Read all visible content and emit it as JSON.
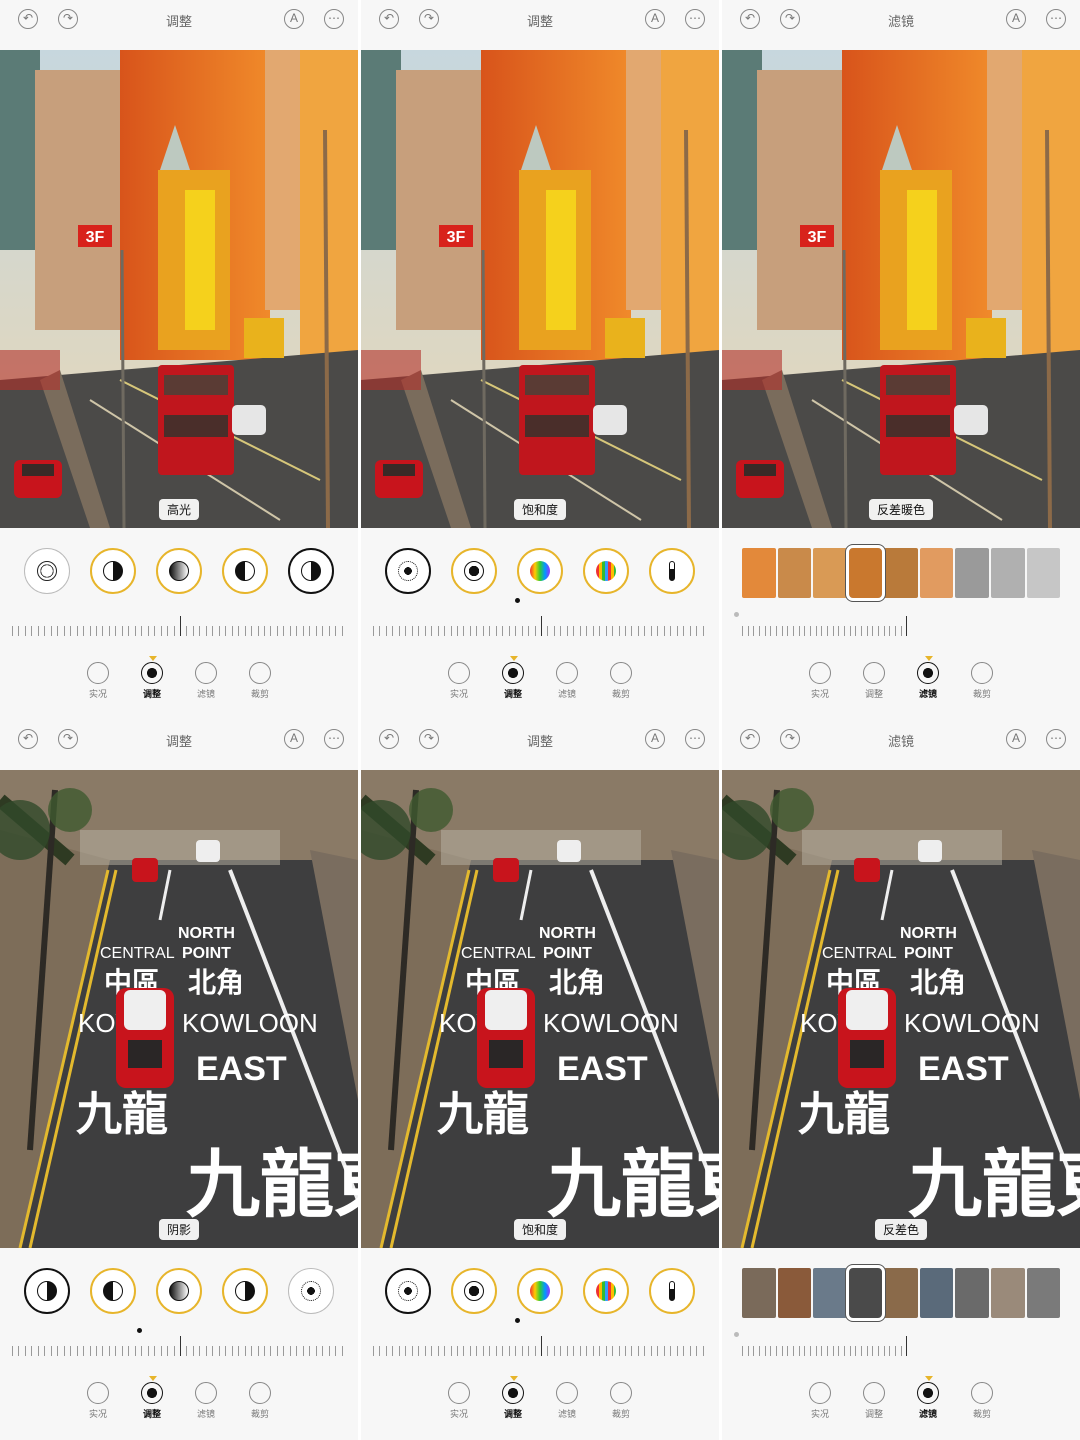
{
  "panels": [
    {
      "title": "调整",
      "label": "高光",
      "mode": "adjust",
      "photo": "city",
      "tools": [
        "exposure-icon",
        "contrast-icon",
        "gradient-icon",
        "half-icon",
        "shadow-icon"
      ],
      "active_nav": "调整"
    },
    {
      "title": "调整",
      "label": "饱和度",
      "mode": "adjust",
      "photo": "city",
      "tools": [
        "brightness-icon",
        "vignette-icon",
        "color-wheel-icon",
        "spectrum-icon",
        "temperature-icon"
      ],
      "active_nav": "调整"
    },
    {
      "title": "滤镜",
      "label": "反差暖色",
      "mode": "filter",
      "photo": "city",
      "active_nav": "滤镜"
    },
    {
      "title": "调整",
      "label": "阴影",
      "mode": "adjust",
      "photo": "road",
      "tools": [
        "shadow-icon",
        "half-icon",
        "gradient-icon",
        "contrast-icon",
        "brightness-icon"
      ],
      "active_nav": "调整"
    },
    {
      "title": "调整",
      "label": "饱和度",
      "mode": "adjust",
      "photo": "road",
      "tools": [
        "brightness-icon",
        "vignette-icon",
        "color-wheel-icon",
        "spectrum-icon",
        "temperature-icon"
      ],
      "active_nav": "调整"
    },
    {
      "title": "滤镜",
      "label": "反差色",
      "mode": "filter",
      "photo": "road",
      "active_nav": "滤镜"
    }
  ],
  "nav": [
    "实况",
    "调整",
    "滤镜",
    "裁剪"
  ],
  "road_text": {
    "north": "NORTH",
    "point": "POINT",
    "central": "CENTRAL",
    "bei_jiao": "北角",
    "zhong_qu": "中區",
    "kowloon": "KOWLOON",
    "kow": "KOW",
    "east": "EAST",
    "jiu_long": "九龍",
    "jiu_long_dong": "九龍東"
  },
  "sign": "3F",
  "colors": {
    "gold": "#e7b52b",
    "bus_red": "#c0161d"
  }
}
